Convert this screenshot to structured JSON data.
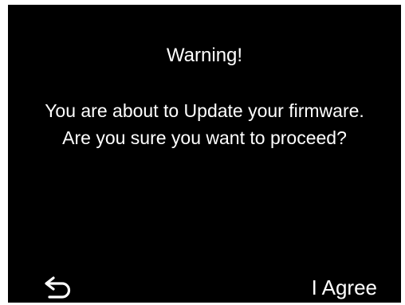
{
  "dialog": {
    "title": "Warning!",
    "message": "You are about to Update your firmware. Are you sure you want to proceed?",
    "back_icon": "back-arrow-icon",
    "agree_label": "I Agree"
  },
  "colors": {
    "background": "#000000",
    "text": "#ffffff"
  }
}
